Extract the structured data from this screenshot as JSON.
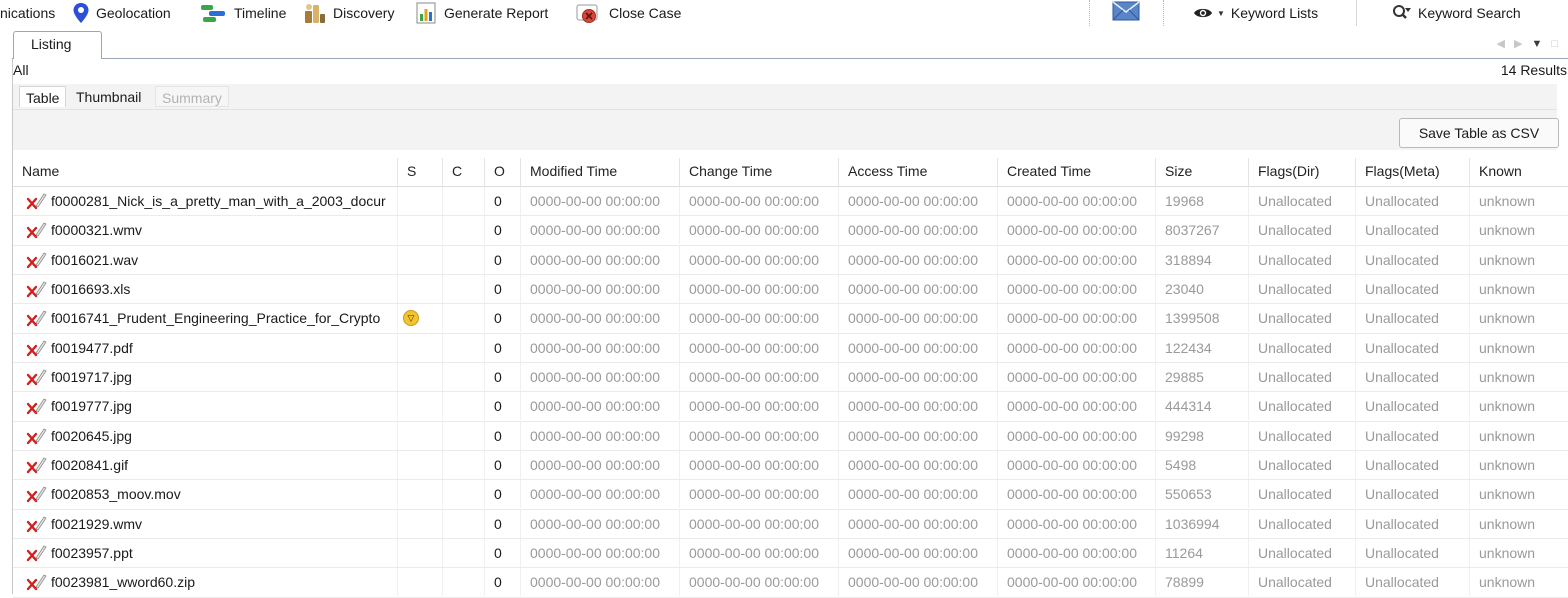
{
  "toolbar": {
    "communications_label": "nications",
    "geolocation_label": "Geolocation",
    "timeline_label": "Timeline",
    "discovery_label": "Discovery",
    "generate_report_label": "Generate Report",
    "close_case_label": "Close Case",
    "keyword_lists_label": "Keyword Lists",
    "keyword_search_label": "Keyword Search"
  },
  "tabs": [
    {
      "label": "Listing",
      "active": true
    }
  ],
  "listing": {
    "filter_label": "All",
    "results_count": "14",
    "results_suffix": "Results",
    "view_tabs": [
      {
        "label": "Table",
        "state": "active"
      },
      {
        "label": "Thumbnail",
        "state": "inactive"
      },
      {
        "label": "Summary",
        "state": "disabled"
      }
    ],
    "save_csv_label": "Save Table as CSV"
  },
  "table": {
    "columns": [
      "Name",
      "S",
      "C",
      "O",
      "Modified Time",
      "Change Time",
      "Access Time",
      "Created Time",
      "Size",
      "Flags(Dir)",
      "Flags(Meta)",
      "Known"
    ],
    "rows": [
      {
        "name": "f0000281_Nick_is_a_pretty_man_with_a_2003_docur",
        "s": "",
        "c": "",
        "o": "0",
        "modified": "0000-00-00 00:00:00",
        "change": "0000-00-00 00:00:00",
        "access": "0000-00-00 00:00:00",
        "created": "0000-00-00 00:00:00",
        "size": "19968",
        "flags_dir": "Unallocated",
        "flags_meta": "Unallocated",
        "known": "unknown"
      },
      {
        "name": "f0000321.wmv",
        "s": "",
        "c": "",
        "o": "0",
        "modified": "0000-00-00 00:00:00",
        "change": "0000-00-00 00:00:00",
        "access": "0000-00-00 00:00:00",
        "created": "0000-00-00 00:00:00",
        "size": "8037267",
        "flags_dir": "Unallocated",
        "flags_meta": "Unallocated",
        "known": "unknown"
      },
      {
        "name": "f0016021.wav",
        "s": "",
        "c": "",
        "o": "0",
        "modified": "0000-00-00 00:00:00",
        "change": "0000-00-00 00:00:00",
        "access": "0000-00-00 00:00:00",
        "created": "0000-00-00 00:00:00",
        "size": "318894",
        "flags_dir": "Unallocated",
        "flags_meta": "Unallocated",
        "known": "unknown"
      },
      {
        "name": "f0016693.xls",
        "s": "",
        "c": "",
        "o": "0",
        "modified": "0000-00-00 00:00:00",
        "change": "0000-00-00 00:00:00",
        "access": "0000-00-00 00:00:00",
        "created": "0000-00-00 00:00:00",
        "size": "23040",
        "flags_dir": "Unallocated",
        "flags_meta": "Unallocated",
        "known": "unknown"
      },
      {
        "name": "f0016741_Prudent_Engineering_Practice_for_Crypto",
        "s": "score-badge",
        "c": "",
        "o": "0",
        "modified": "0000-00-00 00:00:00",
        "change": "0000-00-00 00:00:00",
        "access": "0000-00-00 00:00:00",
        "created": "0000-00-00 00:00:00",
        "size": "1399508",
        "flags_dir": "Unallocated",
        "flags_meta": "Unallocated",
        "known": "unknown"
      },
      {
        "name": "f0019477.pdf",
        "s": "",
        "c": "",
        "o": "0",
        "modified": "0000-00-00 00:00:00",
        "change": "0000-00-00 00:00:00",
        "access": "0000-00-00 00:00:00",
        "created": "0000-00-00 00:00:00",
        "size": "122434",
        "flags_dir": "Unallocated",
        "flags_meta": "Unallocated",
        "known": "unknown"
      },
      {
        "name": "f0019717.jpg",
        "s": "",
        "c": "",
        "o": "0",
        "modified": "0000-00-00 00:00:00",
        "change": "0000-00-00 00:00:00",
        "access": "0000-00-00 00:00:00",
        "created": "0000-00-00 00:00:00",
        "size": "29885",
        "flags_dir": "Unallocated",
        "flags_meta": "Unallocated",
        "known": "unknown"
      },
      {
        "name": "f0019777.jpg",
        "s": "",
        "c": "",
        "o": "0",
        "modified": "0000-00-00 00:00:00",
        "change": "0000-00-00 00:00:00",
        "access": "0000-00-00 00:00:00",
        "created": "0000-00-00 00:00:00",
        "size": "444314",
        "flags_dir": "Unallocated",
        "flags_meta": "Unallocated",
        "known": "unknown"
      },
      {
        "name": "f0020645.jpg",
        "s": "",
        "c": "",
        "o": "0",
        "modified": "0000-00-00 00:00:00",
        "change": "0000-00-00 00:00:00",
        "access": "0000-00-00 00:00:00",
        "created": "0000-00-00 00:00:00",
        "size": "99298",
        "flags_dir": "Unallocated",
        "flags_meta": "Unallocated",
        "known": "unknown"
      },
      {
        "name": "f0020841.gif",
        "s": "",
        "c": "",
        "o": "0",
        "modified": "0000-00-00 00:00:00",
        "change": "0000-00-00 00:00:00",
        "access": "0000-00-00 00:00:00",
        "created": "0000-00-00 00:00:00",
        "size": "5498",
        "flags_dir": "Unallocated",
        "flags_meta": "Unallocated",
        "known": "unknown"
      },
      {
        "name": "f0020853_moov.mov",
        "s": "",
        "c": "",
        "o": "0",
        "modified": "0000-00-00 00:00:00",
        "change": "0000-00-00 00:00:00",
        "access": "0000-00-00 00:00:00",
        "created": "0000-00-00 00:00:00",
        "size": "550653",
        "flags_dir": "Unallocated",
        "flags_meta": "Unallocated",
        "known": "unknown"
      },
      {
        "name": "f0021929.wmv",
        "s": "",
        "c": "",
        "o": "0",
        "modified": "0000-00-00 00:00:00",
        "change": "0000-00-00 00:00:00",
        "access": "0000-00-00 00:00:00",
        "created": "0000-00-00 00:00:00",
        "size": "1036994",
        "flags_dir": "Unallocated",
        "flags_meta": "Unallocated",
        "known": "unknown"
      },
      {
        "name": "f0023957.ppt",
        "s": "",
        "c": "",
        "o": "0",
        "modified": "0000-00-00 00:00:00",
        "change": "0000-00-00 00:00:00",
        "access": "0000-00-00 00:00:00",
        "created": "0000-00-00 00:00:00",
        "size": "11264",
        "flags_dir": "Unallocated",
        "flags_meta": "Unallocated",
        "known": "unknown"
      },
      {
        "name": "f0023981_wword60.zip",
        "s": "",
        "c": "",
        "o": "0",
        "modified": "0000-00-00 00:00:00",
        "change": "0000-00-00 00:00:00",
        "access": "0000-00-00 00:00:00",
        "created": "0000-00-00 00:00:00",
        "size": "78899",
        "flags_dir": "Unallocated",
        "flags_meta": "Unallocated",
        "known": "unknown"
      }
    ]
  },
  "icons": {
    "geolocation": "map-pin-icon",
    "timeline": "timeline-icon",
    "discovery": "discovery-icon",
    "generate_report": "report-icon",
    "close_case": "close-case-icon",
    "email": "envelope-icon",
    "keyword_lists": "eye-icon",
    "keyword_search": "search-icon",
    "file_row": "deleted-file-icon",
    "score": "score-badge-icon"
  },
  "colors": {
    "accent_blue": "#2b6fd6",
    "deleted_red": "#d21f1f",
    "score_yellow": "#f2c530",
    "gray_text": "#9a9a9a",
    "panel_bg": "#f3f3f3"
  }
}
